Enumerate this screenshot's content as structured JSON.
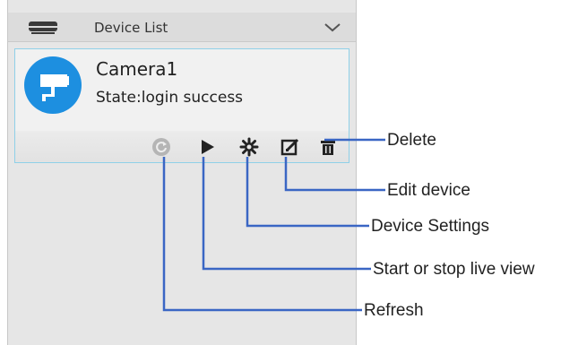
{
  "panel": {
    "title": "Device List",
    "header_icon": "device-list-icon",
    "collapse_icon": "chevron-down-icon"
  },
  "device": {
    "name": "Camera1",
    "state": "State:login success",
    "avatar_icon": "camera-icon",
    "accent_color": "#1d8fe0"
  },
  "toolbar": {
    "buttons": [
      {
        "icon": "refresh-icon"
      },
      {
        "icon": "play-icon"
      },
      {
        "icon": "settings-icon"
      },
      {
        "icon": "edit-icon"
      },
      {
        "icon": "trash-icon"
      }
    ]
  },
  "annotations": {
    "delete": "Delete",
    "edit": "Edit device",
    "settings": "Device Settings",
    "live_view": "Start or stop live view",
    "refresh": "Refresh",
    "line_color": "#3a66c4"
  }
}
